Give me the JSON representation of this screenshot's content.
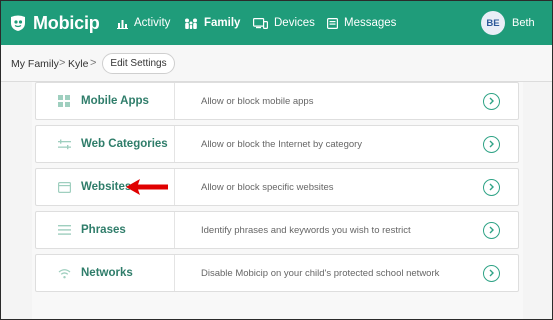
{
  "app": {
    "name": "Mobicip"
  },
  "nav": {
    "items": [
      {
        "label": "Activity",
        "icon": "bar-chart-icon"
      },
      {
        "label": "Family",
        "icon": "family-icon",
        "active": true
      },
      {
        "label": "Devices",
        "icon": "devices-icon"
      },
      {
        "label": "Messages",
        "icon": "messages-icon"
      }
    ]
  },
  "user": {
    "initials": "BE",
    "name": "Beth"
  },
  "breadcrumb": {
    "items": [
      "My Family",
      "Kyle"
    ],
    "separator": ">",
    "button_label": "Edit Settings"
  },
  "settings": {
    "rows": [
      {
        "title": "Mobile Apps",
        "description": "Allow or block mobile apps",
        "icon": "grid-icon"
      },
      {
        "title": "Web Categories",
        "description": "Allow or block the Internet by category",
        "icon": "categories-icon"
      },
      {
        "title": "Websites",
        "description": "Allow or block specific websites",
        "icon": "browser-window-icon",
        "highlighted": true
      },
      {
        "title": "Phrases",
        "description": "Identify phrases and keywords you wish to restrict",
        "icon": "lines-icon"
      },
      {
        "title": "Networks",
        "description": "Disable Mobicip on your child's protected school network",
        "icon": "wifi-icon"
      }
    ]
  },
  "colors": {
    "brand": "#1f9c7a",
    "accent_text": "#2f7d6a",
    "annotation_arrow": "#e00000"
  }
}
